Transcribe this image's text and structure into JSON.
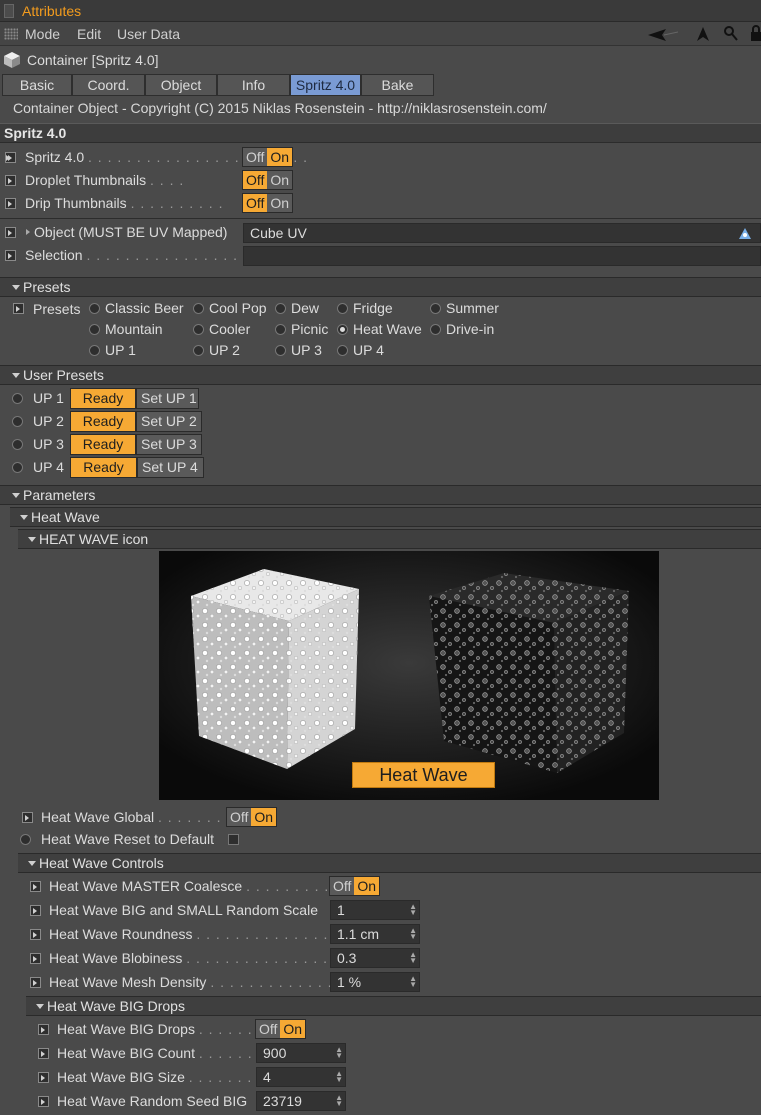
{
  "window": {
    "title": "Attributes"
  },
  "menu": {
    "mode": "Mode",
    "edit": "Edit",
    "user_data": "User Data"
  },
  "object": {
    "name": "Container [Spritz 4.0]"
  },
  "tabs": [
    {
      "label": "Basic"
    },
    {
      "label": "Coord."
    },
    {
      "label": "Object"
    },
    {
      "label": "Info"
    },
    {
      "label": "Spritz 4.0",
      "active": true
    },
    {
      "label": "Bake"
    }
  ],
  "copyright": "Container Object - Copyright (C) 2015 Niklas Rosenstein - http://niklasrosenstein.com/",
  "section_title": "Spritz 4.0",
  "toggles_top": [
    {
      "label": "Spritz 4.0",
      "dots": ". . . . . . . . . . . . . . . . . . . . . . .",
      "value": "On"
    },
    {
      "label": "Droplet Thumbnails",
      "dots": ". . . .",
      "value": "Off"
    },
    {
      "label": "Drip Thumbnails",
      "dots": ". . . . . . . . . .",
      "value": "Off"
    }
  ],
  "toggle_labels": {
    "off": "Off",
    "on": "On"
  },
  "object_field": {
    "label": "Object (MUST BE UV Mapped)",
    "value": "Cube UV"
  },
  "selection_field": {
    "label": "Selection",
    "dots": ". . . . . . . . . . . . . . . . . . .",
    "value": ""
  },
  "presets_group": "Presets",
  "presets_label": "Presets",
  "presets": [
    [
      "Classic Beer",
      "Cool Pop",
      "Dew",
      "Fridge",
      "Summer"
    ],
    [
      "Mountain",
      "Cooler",
      "Picnic",
      "Heat Wave",
      "Drive-in"
    ],
    [
      "UP 1",
      "UP 2",
      "UP 3",
      "UP 4"
    ]
  ],
  "selected_preset": "Heat Wave",
  "user_presets_group": "User Presets",
  "user_presets": [
    {
      "label": "UP 1",
      "status": "Ready",
      "set": "Set UP 1"
    },
    {
      "label": "UP 2",
      "status": "Ready",
      "set": "Set UP 2"
    },
    {
      "label": "UP 3",
      "status": "Ready",
      "set": "Set UP 3"
    },
    {
      "label": "UP 4",
      "status": "Ready",
      "set": "Set UP 4"
    }
  ],
  "parameters_group": "Parameters",
  "heatwave_group": "Heat Wave",
  "heatwave_icon_group": "HEAT WAVE icon",
  "banner_text": "Heat Wave",
  "heatwave_global": {
    "label": "Heat Wave Global",
    "dots": ". . . . . . . . . . .",
    "value": "On"
  },
  "heatwave_reset": {
    "label": "Heat Wave Reset to Default"
  },
  "controls_group": "Heat Wave Controls",
  "controls": [
    {
      "label": "Heat Wave MASTER Coalesce",
      "dots": ". . . . . . . . . . . . .",
      "type": "toggle",
      "value": "On"
    },
    {
      "label": "Heat Wave BIG and SMALL Random Scale",
      "dots": "",
      "type": "number",
      "value": "1"
    },
    {
      "label": "Heat Wave Roundness",
      "dots": ". . . . . . . . . . . . . . . .",
      "type": "number",
      "value": "1.1 cm"
    },
    {
      "label": "Heat Wave Blobiness",
      "dots": ". . . . . . . . . . . . . . . . .",
      "type": "number",
      "value": "0.3"
    },
    {
      "label": "Heat Wave Mesh Density",
      "dots": ". . . . . . . . . . . . . .",
      "type": "number",
      "value": "1 %"
    }
  ],
  "big_drops_group": "Heat Wave BIG Drops",
  "big_drops": [
    {
      "label": "Heat Wave BIG Drops",
      "dots": ". . . . . . . . .",
      "type": "toggle",
      "value": "On"
    },
    {
      "label": "Heat Wave BIG Count",
      "dots": ". . . . . . . . .",
      "type": "number",
      "value": "900"
    },
    {
      "label": "Heat Wave BIG Size",
      "dots": ". . . . . . . . . . . .",
      "type": "number",
      "value": "4"
    },
    {
      "label": "Heat Wave Random Seed BIG",
      "dots": "",
      "type": "number",
      "value": "23719"
    }
  ],
  "colors": {
    "accent": "#f6a934",
    "title": "#f39c1e",
    "tab_active": "#7a9bd4",
    "bg": "#4a4a4a"
  }
}
